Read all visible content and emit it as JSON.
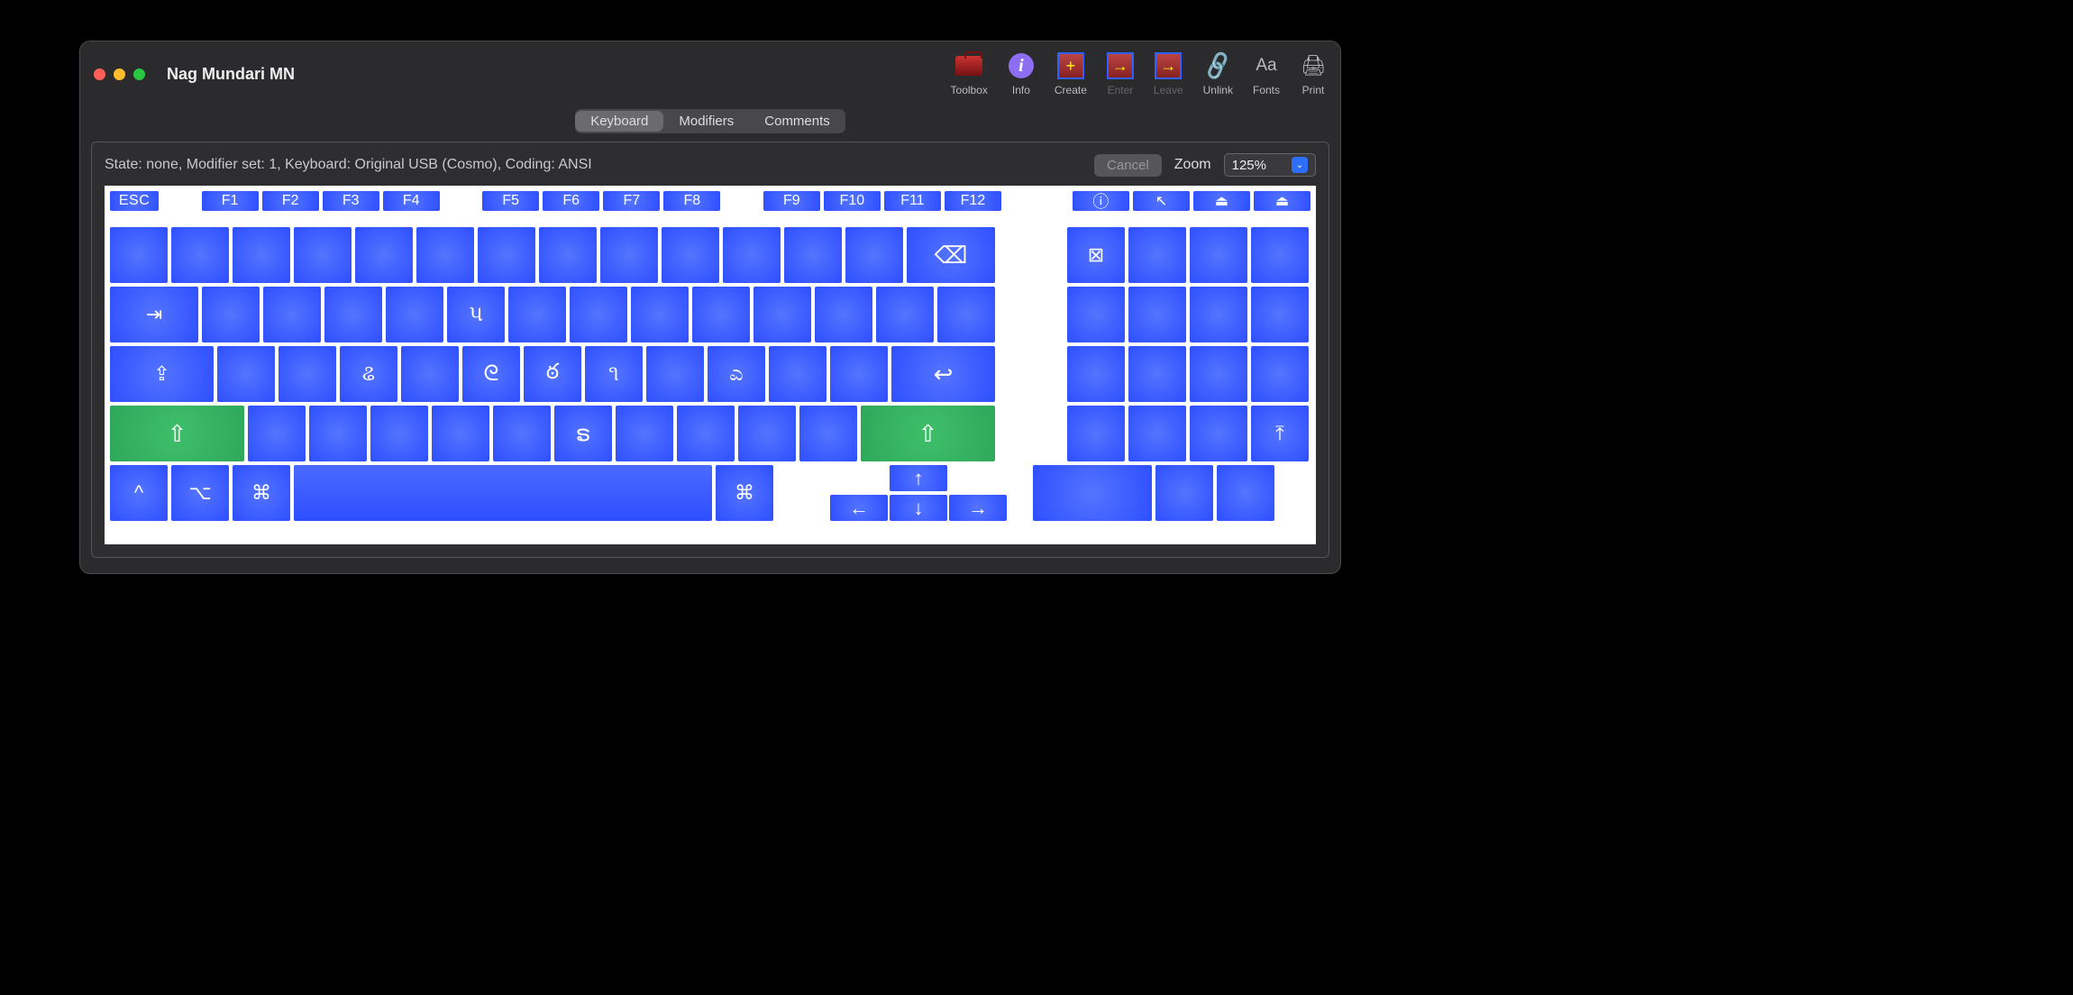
{
  "window": {
    "title": "Nag Mundari MN"
  },
  "toolbar": {
    "toolbox": "Toolbox",
    "info": "Info",
    "create": "Create",
    "enter": "Enter",
    "leave": "Leave",
    "unlink": "Unlink",
    "fonts": "Fonts",
    "print": "Print"
  },
  "tabs": {
    "keyboard": "Keyboard",
    "modifiers": "Modifiers",
    "comments": "Comments",
    "active": "keyboard"
  },
  "status": {
    "text": "State: none, Modifier set: 1, Keyboard: Original USB (Cosmo), Coding: ANSI",
    "cancel": "Cancel",
    "zoom_label": "Zoom",
    "zoom_value": "125%"
  },
  "keys": {
    "esc": "ESC",
    "f1": "F1",
    "f2": "F2",
    "f3": "F3",
    "f4": "F4",
    "f5": "F5",
    "f6": "F6",
    "f7": "F7",
    "f8": "F8",
    "f9": "F9",
    "f10": "F10",
    "f11": "F11",
    "f12": "F12",
    "help": "?",
    "backspace": "⌫",
    "clear": "⊠",
    "tab": "⇥",
    "capslock": "⇪",
    "return": "↩",
    "lshift": "⇧",
    "rshift": "⇧",
    "control": "^",
    "option": "⌥",
    "command": "⌘",
    "up": "↑",
    "down": "↓",
    "left": "←",
    "right": "→",
    "pgup_sym": "⤒",
    "home_sym": "↖",
    "eject1": "⏏",
    "eject2": "⏏",
    "row_q": {
      "5": "પ"
    },
    "row_a": {
      "3": "ଌ",
      "5": "ᘓ",
      "6": "ఠ",
      "7": "૧",
      "9": "ಎ"
    },
    "row_z": {
      "5": "ຣ"
    }
  }
}
